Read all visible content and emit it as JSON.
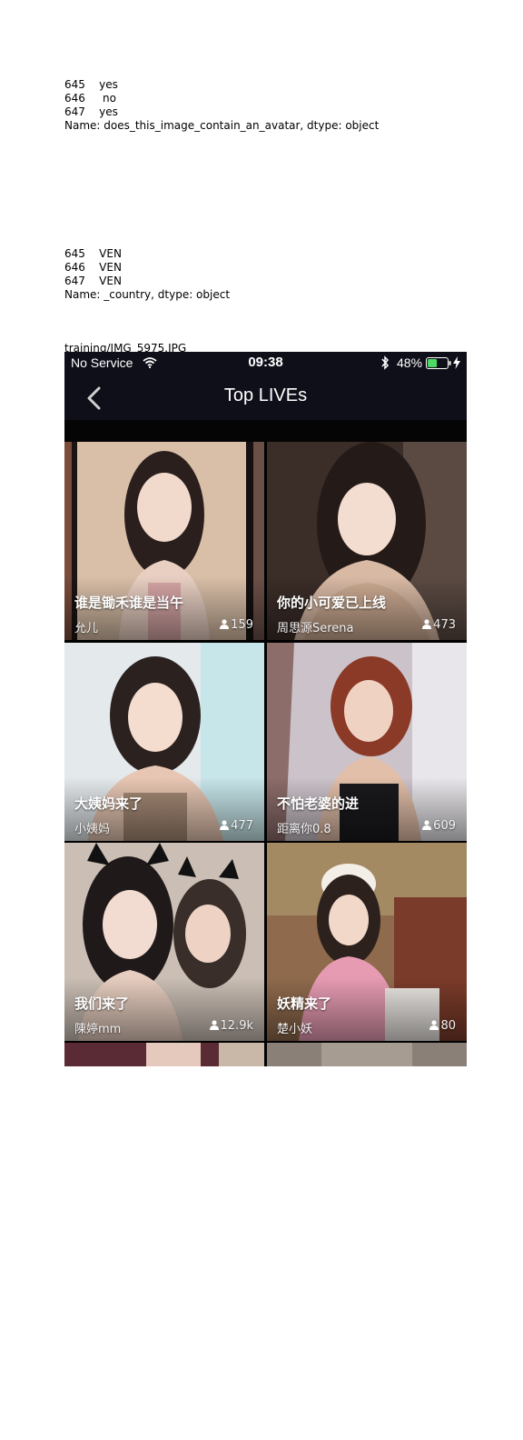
{
  "dump_avatar": {
    "rows": [
      {
        "index": "645",
        "value": "yes"
      },
      {
        "index": "646",
        "value": " no"
      },
      {
        "index": "647",
        "value": "yes"
      }
    ],
    "footer": "Name: does_this_image_contain_an_avatar, dtype: object"
  },
  "dump_country": {
    "rows": [
      {
        "index": "645",
        "value": "VEN"
      },
      {
        "index": "646",
        "value": "VEN"
      },
      {
        "index": "647",
        "value": "VEN"
      }
    ],
    "footer": "Name: _country, dtype: object"
  },
  "caption": "training/IMG_5975.JPG",
  "status_bar": {
    "carrier": "No Service",
    "time": "09:38",
    "battery": "48%",
    "battery_level": 0.48,
    "icons": [
      "wifi-icon",
      "bluetooth-icon",
      "battery-icon",
      "charging-icon"
    ]
  },
  "nav": {
    "title": "Top LIVEs",
    "back_icon": "chevron-left-icon"
  },
  "streams": [
    {
      "title": "谁是锄禾谁是当午",
      "name": "允儿",
      "viewers": "159"
    },
    {
      "title": "你的小可爱已上线",
      "name": "周思源Serena",
      "viewers": "473"
    },
    {
      "title": "大姨妈来了",
      "name": "小姨妈",
      "viewers": "477"
    },
    {
      "title": "不怕老婆的进",
      "name": "距离你0.8",
      "viewers": "609"
    },
    {
      "title": "我们来了",
      "name": "陳婷mm",
      "viewers": "12.9k"
    },
    {
      "title": "妖精来了",
      "name": "楚小妖",
      "viewers": "80"
    }
  ],
  "colors": {
    "bar_bg": "#0f0f1a",
    "battery_fill": "#4cd964"
  }
}
